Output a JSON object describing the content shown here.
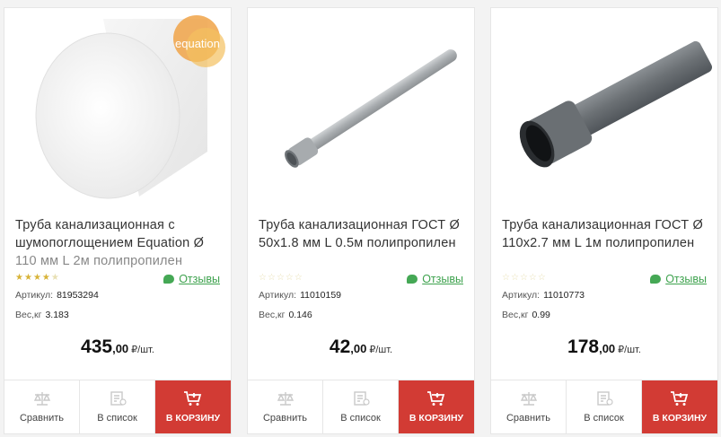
{
  "products": [
    {
      "title_lines": [
        "Труба канализационная с",
        "шумопоглощением Equation Ø",
        "110 мм L 2м полипропилен"
      ],
      "brand_badge": "equation",
      "rating": 3.5,
      "reviews_label": "Отзывы",
      "sku_label": "Артикул:",
      "sku": "81953294",
      "weight_label": "Вес,кг",
      "weight": "3.183",
      "price_int": "435",
      "price_dec": ",00",
      "price_unit": "₽/шт.",
      "compare_label": "Сравнить",
      "list_label": "В список",
      "cart_label": "В КОРЗИНУ",
      "image": "white-soundproof-pipe"
    },
    {
      "title_lines": [
        "Труба канализационная ГОСТ Ø",
        "50x1.8 мм L 0.5м полипропилен"
      ],
      "rating": 0,
      "reviews_label": "Отзывы",
      "sku_label": "Артикул:",
      "sku": "11010159",
      "weight_label": "Вес,кг",
      "weight": "0.146",
      "price_int": "42",
      "price_dec": ",00",
      "price_unit": "₽/шт.",
      "compare_label": "Сравнить",
      "list_label": "В список",
      "cart_label": "В КОРЗИНУ",
      "image": "thin-grey-pipe"
    },
    {
      "title_lines": [
        "Труба канализационная ГОСТ Ø",
        "110x2.7 мм L 1м полипропилен"
      ],
      "rating": 0,
      "reviews_label": "Отзывы",
      "sku_label": "Артикул:",
      "sku": "11010773",
      "weight_label": "Вес,кг",
      "weight": "0.99",
      "price_int": "178",
      "price_dec": ",00",
      "price_unit": "₽/шт.",
      "compare_label": "Сравнить",
      "list_label": "В список",
      "cart_label": "В КОРЗИНУ",
      "image": "dark-grey-pipe"
    }
  ],
  "colors": {
    "cart": "#d23b34",
    "reviews": "#3ea24e",
    "star_on": "#d8b338",
    "star_off": "#e8e0b4"
  }
}
